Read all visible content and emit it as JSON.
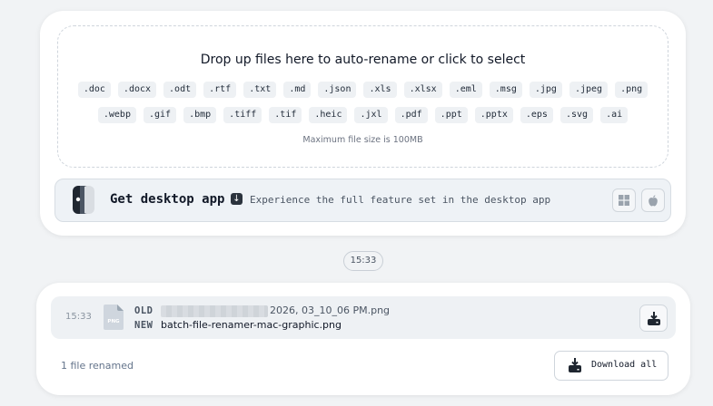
{
  "dropzone": {
    "title": "Drop up files here to auto-rename or click to select",
    "extensions_row1": [
      ".doc",
      ".docx",
      ".odt",
      ".rtf",
      ".txt",
      ".md",
      ".json",
      ".xls",
      ".xlsx",
      ".eml",
      ".msg",
      ".jpg",
      ".jpeg",
      ".png"
    ],
    "extensions_row2": [
      ".webp",
      ".gif",
      ".bmp",
      ".tiff",
      ".tif",
      ".heic",
      ".jxl",
      ".pdf",
      ".ppt",
      ".pptx",
      ".eps",
      ".svg",
      ".ai"
    ],
    "max_size": "Maximum file size is 100MB"
  },
  "desktop_banner": {
    "title": "Get desktop app",
    "subtitle": "Experience the full feature set in the desktop app",
    "icons": [
      "app-logo-icon",
      "download-arrow-icon",
      "windows-icon",
      "apple-icon"
    ]
  },
  "timeline": {
    "time": "15:33"
  },
  "result": {
    "row": {
      "time": "15:33",
      "file_type": "PNG",
      "old_label": "OLD",
      "old_name_visible": "2026, 03_10_06 PM.png",
      "new_label": "NEW",
      "new_name": "batch-file-renamer-mac-graphic.png"
    },
    "summary": "1 file renamed",
    "download_all_label": "Download all"
  },
  "colors": {
    "background": "#f1f3f5",
    "card": "#ffffff",
    "chip": "#eef1f4",
    "banner": "#eef2f6",
    "dark_icon": "#1f2630"
  }
}
